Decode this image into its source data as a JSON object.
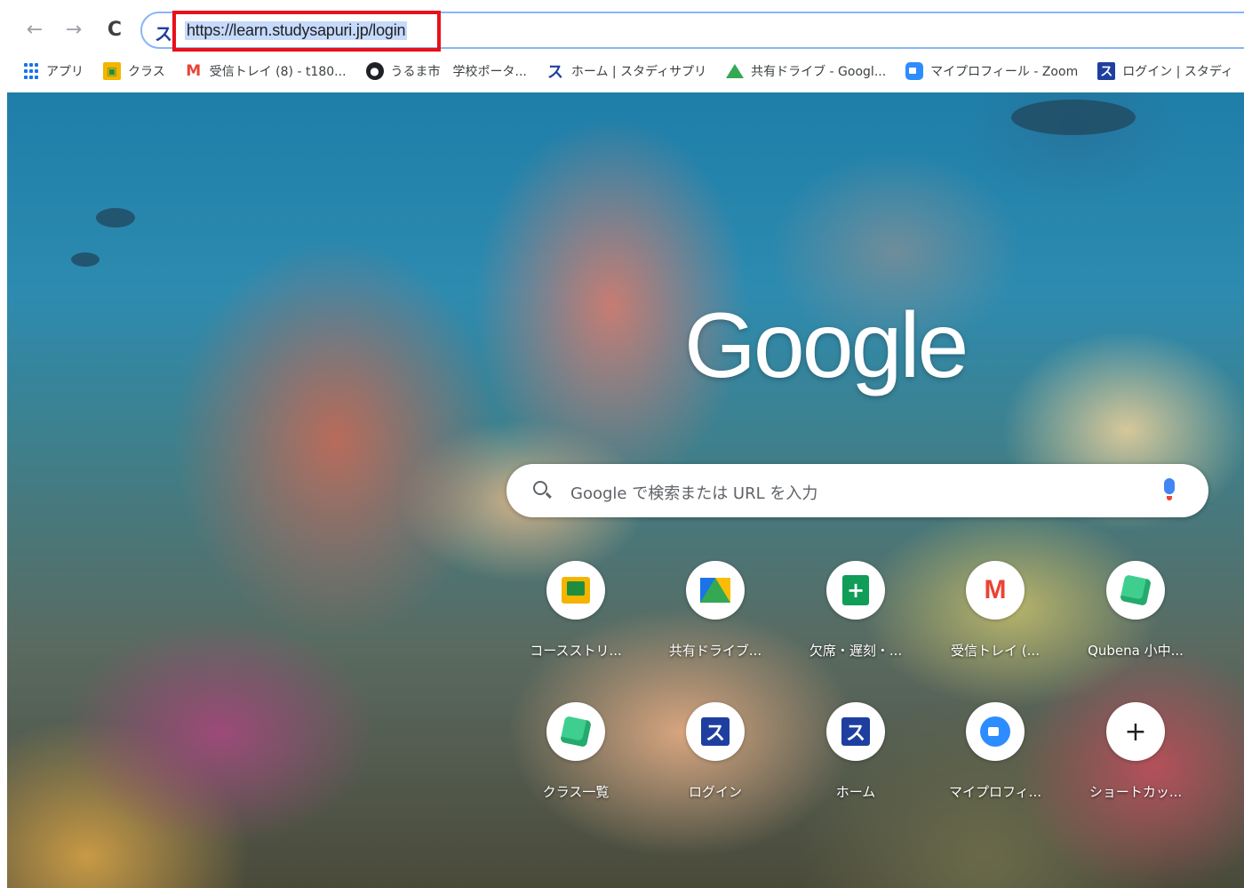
{
  "toolbar": {
    "back_icon": "←",
    "forward_icon": "→",
    "reload_icon": "C",
    "favicon_glyph": "ス",
    "url": "https://learn.studysapuri.jp/login"
  },
  "bookmarks": [
    {
      "icon": "apps-grid-icon",
      "label": "アプリ"
    },
    {
      "icon": "classroom-icon",
      "label": "クラス"
    },
    {
      "icon": "gmail-icon",
      "label": "受信トレイ (8) - t180..."
    },
    {
      "icon": "globe-icon",
      "label": "うるま市　学校ポータ..."
    },
    {
      "icon": "studysapuri-icon",
      "label": "ホーム | スタディサプリ"
    },
    {
      "icon": "drive-icon",
      "label": "共有ドライブ - Googl..."
    },
    {
      "icon": "zoom-icon",
      "label": "マイプロフィール - Zoom"
    },
    {
      "icon": "studysapuri-box-icon",
      "label": "ログイン | スタディ"
    }
  ],
  "ntp": {
    "logo": "Google",
    "search_placeholder": "Google で検索または URL を入力",
    "shortcuts": [
      {
        "icon": "classroom-icon",
        "label": "コースストリ..."
      },
      {
        "icon": "drive-icon",
        "label": "共有ドライブ..."
      },
      {
        "icon": "sheets-icon",
        "label": "欠席・遅刻・..."
      },
      {
        "icon": "gmail-icon",
        "label": "受信トレイ (..."
      },
      {
        "icon": "qubena-cube-icon",
        "label": "Qubena 小中..."
      },
      {
        "icon": "qubena-cube-icon",
        "label": "クラス一覧"
      },
      {
        "icon": "studysapuri-icon",
        "label": "ログイン"
      },
      {
        "icon": "studysapuri-icon",
        "label": "ホーム"
      },
      {
        "icon": "zoom-icon",
        "label": "マイプロフィ..."
      },
      {
        "icon": "plus-icon",
        "label": "ショートカッ..."
      }
    ]
  },
  "colors": {
    "highlight": "#e8101a",
    "omnibox_border": "#8ab4f8",
    "url_selection": "#c6dafc"
  }
}
